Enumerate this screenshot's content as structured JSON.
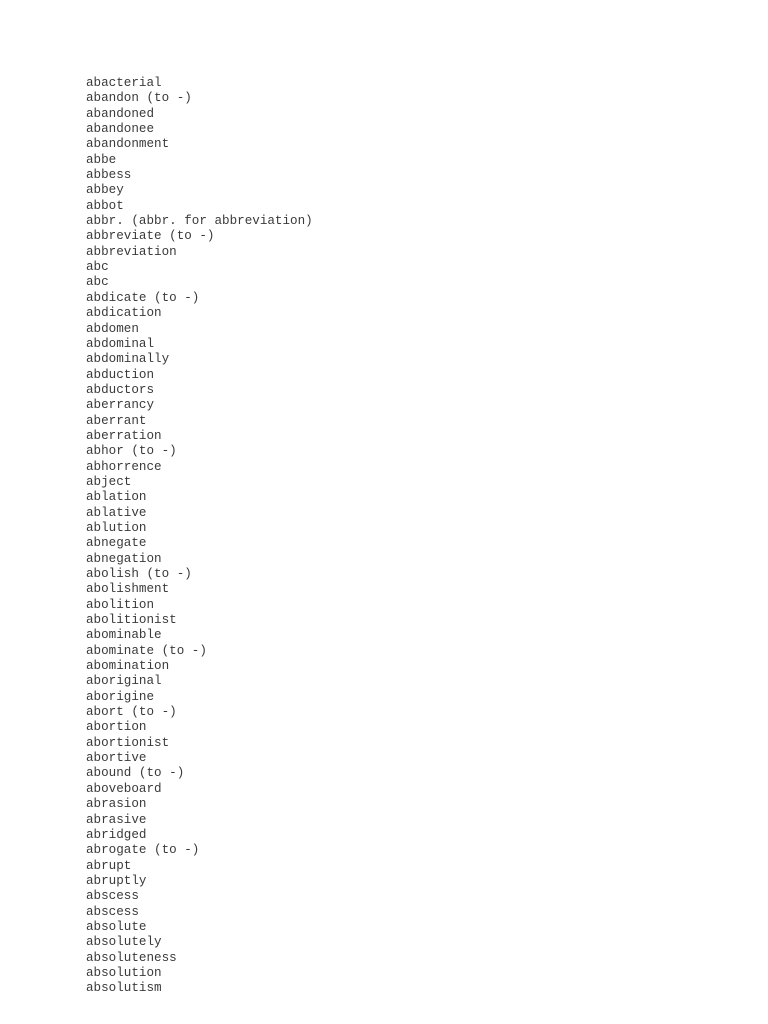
{
  "document": {
    "entries": [
      "abacterial",
      "abandon (to -)",
      "abandoned",
      "abandonee",
      "abandonment",
      "abbe",
      "abbess",
      "abbey",
      "abbot",
      "abbr. (abbr. for abbreviation)",
      "abbreviate (to -)",
      "abbreviation",
      "abc",
      "abc",
      "abdicate (to -)",
      "abdication",
      "abdomen",
      "abdominal",
      "abdominally",
      "abduction",
      "abductors",
      "aberrancy",
      "aberrant",
      "aberration",
      "abhor (to -)",
      "abhorrence",
      "abject",
      "ablation",
      "ablative",
      "ablution",
      "abnegate",
      "abnegation",
      "abolish (to -)",
      "abolishment",
      "abolition",
      "abolitionist",
      "abominable",
      "abominate (to -)",
      "abomination",
      "aboriginal",
      "aborigine",
      "abort (to -)",
      "abortion",
      "abortionist",
      "abortive",
      "abound (to -)",
      "aboveboard",
      "abrasion",
      "abrasive",
      "abridged",
      "abrogate (to -)",
      "abrupt",
      "abruptly",
      "abscess",
      "abscess",
      "absolute",
      "absolutely",
      "absoluteness",
      "absolution",
      "absolutism"
    ]
  }
}
